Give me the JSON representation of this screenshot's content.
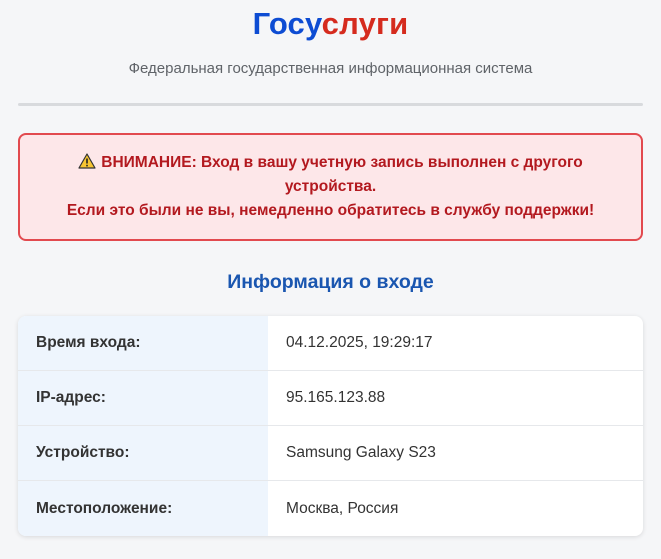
{
  "header": {
    "logo_part_a": "Госу",
    "logo_part_b": "слуги",
    "subtitle": "Федеральная государственная информационная система"
  },
  "alert": {
    "icon": "warning-icon",
    "line1": "ВНИМАНИЕ: Вход в вашу учетную запись выполнен с другого устройства.",
    "line2": "Если это были не вы, немедленно обратитесь в службу поддержки!",
    "color_text": "#b3191f",
    "color_border": "#e24a4f",
    "color_background": "#fde7e9"
  },
  "login_info": {
    "title": "Информация о входе",
    "rows": [
      {
        "label": "Время входа:",
        "value": "04.12.2025, 19:29:17"
      },
      {
        "label": "IP-адрес:",
        "value": "95.165.123.88"
      },
      {
        "label": "Устройство:",
        "value": "Samsung Galaxy S23"
      },
      {
        "label": "Местоположение:",
        "value": "Москва, Россия"
      }
    ]
  },
  "colors": {
    "brand_blue": "#0d4cd3",
    "brand_red": "#d52b1e",
    "section_title": "#1a56b0"
  }
}
